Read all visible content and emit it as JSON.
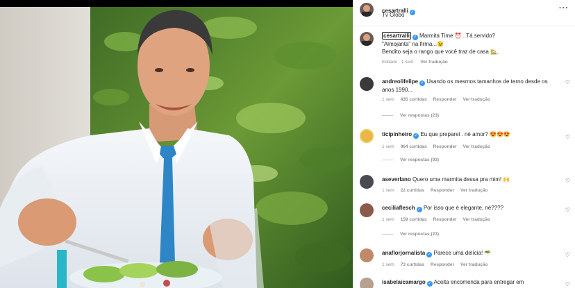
{
  "post": {
    "author": "cesartralli",
    "location": "Tv Globo",
    "more": "···",
    "caption_user": "cesartralli",
    "caption_line1": "Marmita Time ⏰ . Tá servido?",
    "caption_line2": "\"Almojanta\" na firma...😉",
    "caption_line3": "Bendito seja o rango que você traz de casa 🏡.",
    "edited": "Editado · 1 sem",
    "see_translation": "Ver tradução"
  },
  "comments": [
    {
      "user": "andreolifelipe",
      "verified": true,
      "text": "Usando os mesmos tamanhos de terno desde os anos 1990...",
      "time": "1 sem",
      "likes": "435 curtidas",
      "reply": "Responder",
      "translate": "Ver tradução",
      "replies": "Ver respostas (23)"
    },
    {
      "user": "ticipinheiro",
      "verified": true,
      "text": "Eu que preparei . né amor? 😍😍😍",
      "time": "1 sem",
      "likes": "964 curtidas",
      "reply": "Responder",
      "translate": "Ver tradução",
      "replies": "Ver respostas (93)"
    },
    {
      "user": "aseverlano",
      "verified": false,
      "text": "Quero uma marmita dessa pra mim! 🙌",
      "time": "1 sem",
      "likes": "22 curtidas",
      "reply": "Responder",
      "translate": "Ver tradução",
      "replies": ""
    },
    {
      "user": "ceciliaflesch",
      "verified": true,
      "text": "Por isso que é elegante, né????",
      "time": "1 sem",
      "likes": "159 curtidas",
      "reply": "Responder",
      "translate": "Ver tradução",
      "replies": "Ver respostas (23)"
    },
    {
      "user": "anaflorjornalista",
      "verified": true,
      "text": "Parece uma delícia! 🥗",
      "time": "1 sem",
      "likes": "73 curtidas",
      "reply": "Responder",
      "translate": "Ver tradução",
      "replies": ""
    },
    {
      "user": "isabelaicamargo",
      "verified": true,
      "text": "Aceita encomenda para entregar em",
      "time": "",
      "likes": "",
      "reply": "",
      "translate": "",
      "replies": ""
    }
  ],
  "icons": {
    "verified": "verified-badge-icon",
    "heart": "heart-icon",
    "more": "more-options-icon"
  },
  "colors": {
    "verified": "#3897f0",
    "meta": "#8e8e8e",
    "text": "#262626",
    "tie": "#2f86c6",
    "shirt": "#eef2f6"
  }
}
